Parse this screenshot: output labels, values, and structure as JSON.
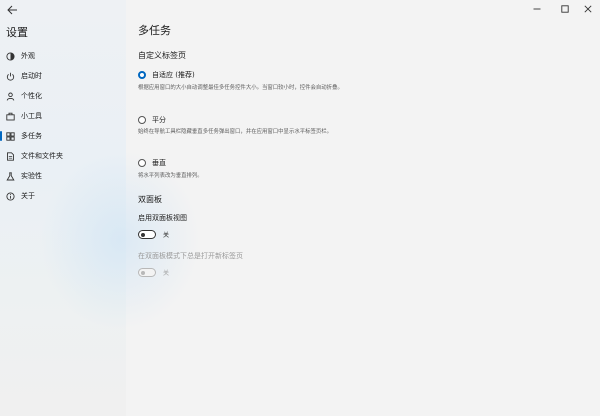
{
  "window": {
    "title": "设置",
    "controls": {
      "minimize": "—",
      "maximize": "☐",
      "close": "✕"
    }
  },
  "sidebar": {
    "items": [
      {
        "label": "外观",
        "icon": "appearance-icon"
      },
      {
        "label": "启动时",
        "icon": "power-icon"
      },
      {
        "label": "个性化",
        "icon": "person-icon"
      },
      {
        "label": "小工具",
        "icon": "tools-icon"
      },
      {
        "label": "多任务",
        "icon": "multitask-icon",
        "active": true
      },
      {
        "label": "文件和文件夹",
        "icon": "file-icon"
      },
      {
        "label": "实验性",
        "icon": "experimental-icon"
      },
      {
        "label": "关于",
        "icon": "info-icon"
      }
    ]
  },
  "main": {
    "title": "多任务",
    "tabs_section": {
      "title": "自定义标签页",
      "options": [
        {
          "label": "自适应 (推荐)",
          "checked": true,
          "desc": "根据应用窗口的大小自动调整最佳多任务控件大小。当窗口较小时，控件会自动折叠。"
        },
        {
          "label": "平分",
          "checked": false,
          "desc": "始终在导航工具栏隐藏垂直多任务弹出窗口，并在应用窗口中显示水平标签页栏。"
        },
        {
          "label": "垂直",
          "checked": false,
          "desc": "将水平列表改为垂直排列。"
        }
      ]
    },
    "dual_pane": {
      "title": "双面板",
      "enable_label": "启用双面板视图",
      "enable_state": "关",
      "new_tab_label": "在双面板模式下总是打开新标签页",
      "new_tab_state": "关"
    }
  },
  "colors": {
    "accent": "#0067c0"
  }
}
